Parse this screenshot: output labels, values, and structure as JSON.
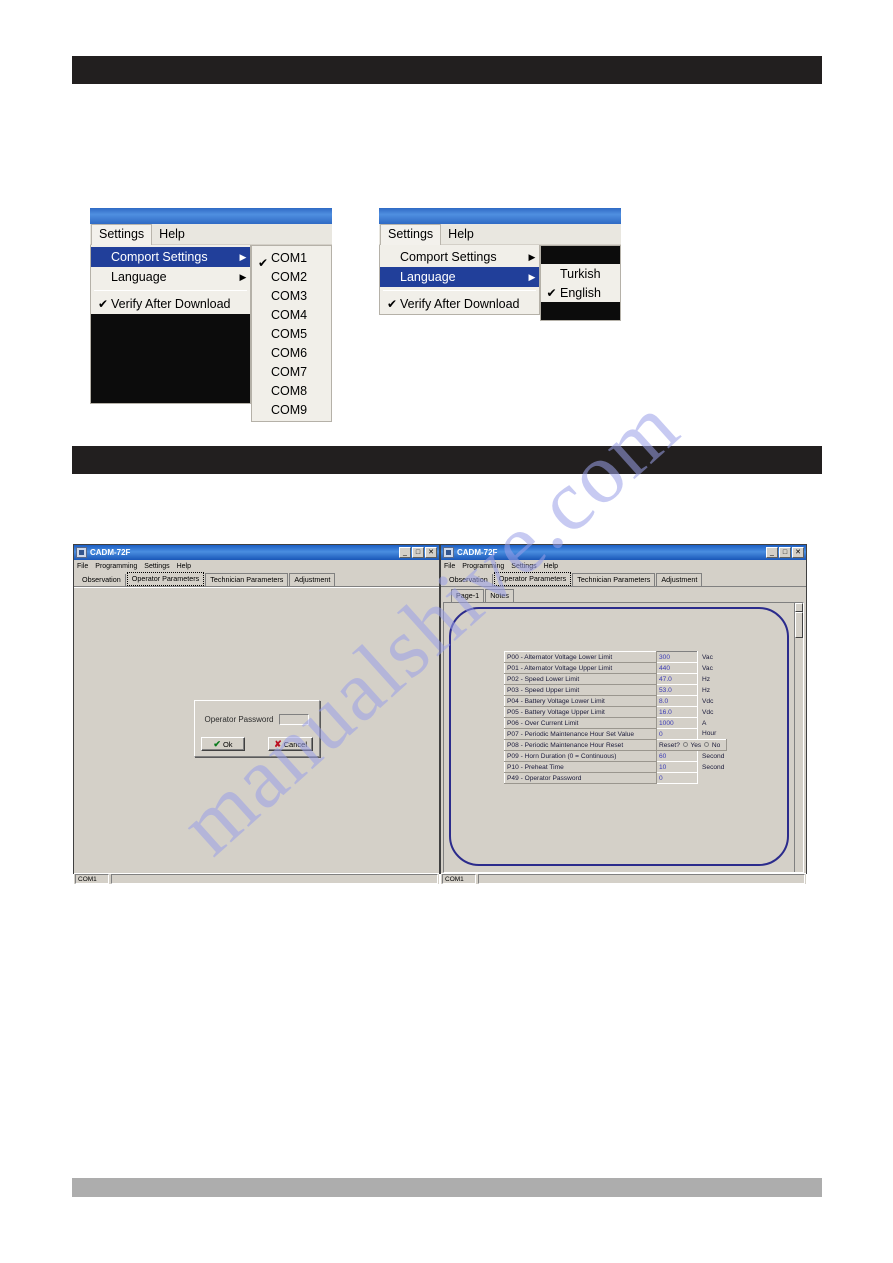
{
  "page": {
    "watermark_text": "manualshive.com",
    "bars": [
      {
        "name": "top-black-bar",
        "text": "",
        "color": "#221f1f"
      },
      {
        "name": "mid-black-bar",
        "text": "",
        "color": "#221f1f"
      },
      {
        "name": "bottom-gray-bar",
        "text": "",
        "color": "#adadad"
      }
    ]
  },
  "menu_comport": {
    "menubar": {
      "settings": "Settings",
      "help": "Help"
    },
    "items": [
      {
        "label": "Comport Settings",
        "checked": false,
        "submenu": true,
        "selected": true
      },
      {
        "label": "Language",
        "checked": false,
        "submenu": true,
        "selected": false
      }
    ],
    "verify": {
      "label": "Verify After Download",
      "checked": true,
      "check_glyph": "✔"
    },
    "submenu_title": "",
    "comports": [
      {
        "label": "COM1",
        "checked": true
      },
      {
        "label": "COM2",
        "checked": false
      },
      {
        "label": "COM3",
        "checked": false
      },
      {
        "label": "COM4",
        "checked": false
      },
      {
        "label": "COM5",
        "checked": false
      },
      {
        "label": "COM6",
        "checked": false
      },
      {
        "label": "COM7",
        "checked": false
      },
      {
        "label": "COM8",
        "checked": false
      },
      {
        "label": "COM9",
        "checked": false
      }
    ],
    "arrow_glyph": "▶",
    "check_glyph": "✔"
  },
  "menu_language": {
    "menubar": {
      "settings": "Settings",
      "help": "Help"
    },
    "items": [
      {
        "label": "Comport Settings",
        "checked": false,
        "submenu": true,
        "selected": false
      },
      {
        "label": "Language",
        "checked": false,
        "submenu": true,
        "selected": true
      }
    ],
    "verify": {
      "label": "Verify After Download",
      "checked": true,
      "check_glyph": "✔"
    },
    "languages": [
      {
        "label": "Turkish",
        "checked": false
      },
      {
        "label": "English",
        "checked": true
      }
    ],
    "arrow_glyph": "▶",
    "check_glyph": "✔"
  },
  "window_left": {
    "title": "CADM-72F",
    "buttons": {
      "minimize": "_",
      "maximize": "□",
      "close": "✕"
    },
    "menubar": [
      "File",
      "Programming",
      "Settings",
      "Help"
    ],
    "tabs": [
      {
        "label": "Observation",
        "selected": false
      },
      {
        "label": "Operator Parameters",
        "selected": true
      },
      {
        "label": "Technician Parameters",
        "selected": false
      },
      {
        "label": "Adjustment",
        "selected": false
      }
    ],
    "dialog": {
      "label": "Operator Password",
      "input_value": "",
      "input_placeholder": "",
      "ok_label": "Ok",
      "cancel_label": "Cancel",
      "ok_glyph": "✔",
      "cancel_glyph": "✘"
    },
    "status": {
      "port": "COM1",
      "message": ""
    }
  },
  "window_right": {
    "title": "CADM-72F",
    "buttons": {
      "minimize": "_",
      "maximize": "□",
      "close": "✕"
    },
    "menubar": [
      "File",
      "Programming",
      "Settings",
      "Help"
    ],
    "tabs": [
      {
        "label": "Observation",
        "selected": false
      },
      {
        "label": "Operator Parameters",
        "selected": true
      },
      {
        "label": "Technician Parameters",
        "selected": false
      },
      {
        "label": "Adjustment",
        "selected": false
      }
    ],
    "subtabs": [
      {
        "label": "Page-1",
        "selected": true
      },
      {
        "label": "Notes",
        "selected": false
      }
    ],
    "annotation_color": "#2b2b8c",
    "parameters": [
      {
        "name": "P00 - Alternator Voltage Lower Limit",
        "value": "300",
        "unit": "Vac",
        "type": "text"
      },
      {
        "name": "P01 - Alternator Voltage Upper Limit",
        "value": "440",
        "unit": "Vac",
        "type": "text"
      },
      {
        "name": "P02 - Speed Lower Limit",
        "value": "47.0",
        "unit": "Hz",
        "type": "text"
      },
      {
        "name": "P03 - Speed Upper Limit",
        "value": "53.0",
        "unit": "Hz",
        "type": "text"
      },
      {
        "name": "P04 - Battery Voltage Lower Limit",
        "value": "8.0",
        "unit": "Vdc",
        "type": "text"
      },
      {
        "name": "P05 - Battery Voltage Upper Limit",
        "value": "16.0",
        "unit": "Vdc",
        "type": "text"
      },
      {
        "name": "P06 - Over Current Limit",
        "value": "1000",
        "unit": "A",
        "type": "text"
      },
      {
        "name": "P07 - Periodic Maintenance Hour Set Value",
        "value": "0",
        "unit": "Hour",
        "type": "text"
      },
      {
        "name": "P08 - Periodic Maintenance Hour Reset",
        "value": "",
        "unit": "",
        "type": "radio",
        "radio_prompt": "Reset?",
        "radio_options": [
          "Yes",
          "No"
        ]
      },
      {
        "name": "P09 - Horn Duration (0 = Continuous)",
        "value": "60",
        "unit": "Second",
        "type": "text"
      },
      {
        "name": "P10 - Preheat Time",
        "value": "10",
        "unit": "Second",
        "type": "text"
      },
      {
        "name": "P49 - Operator Password",
        "value": "0",
        "unit": "",
        "type": "text"
      }
    ],
    "status": {
      "port": "COM1",
      "message": ""
    }
  }
}
